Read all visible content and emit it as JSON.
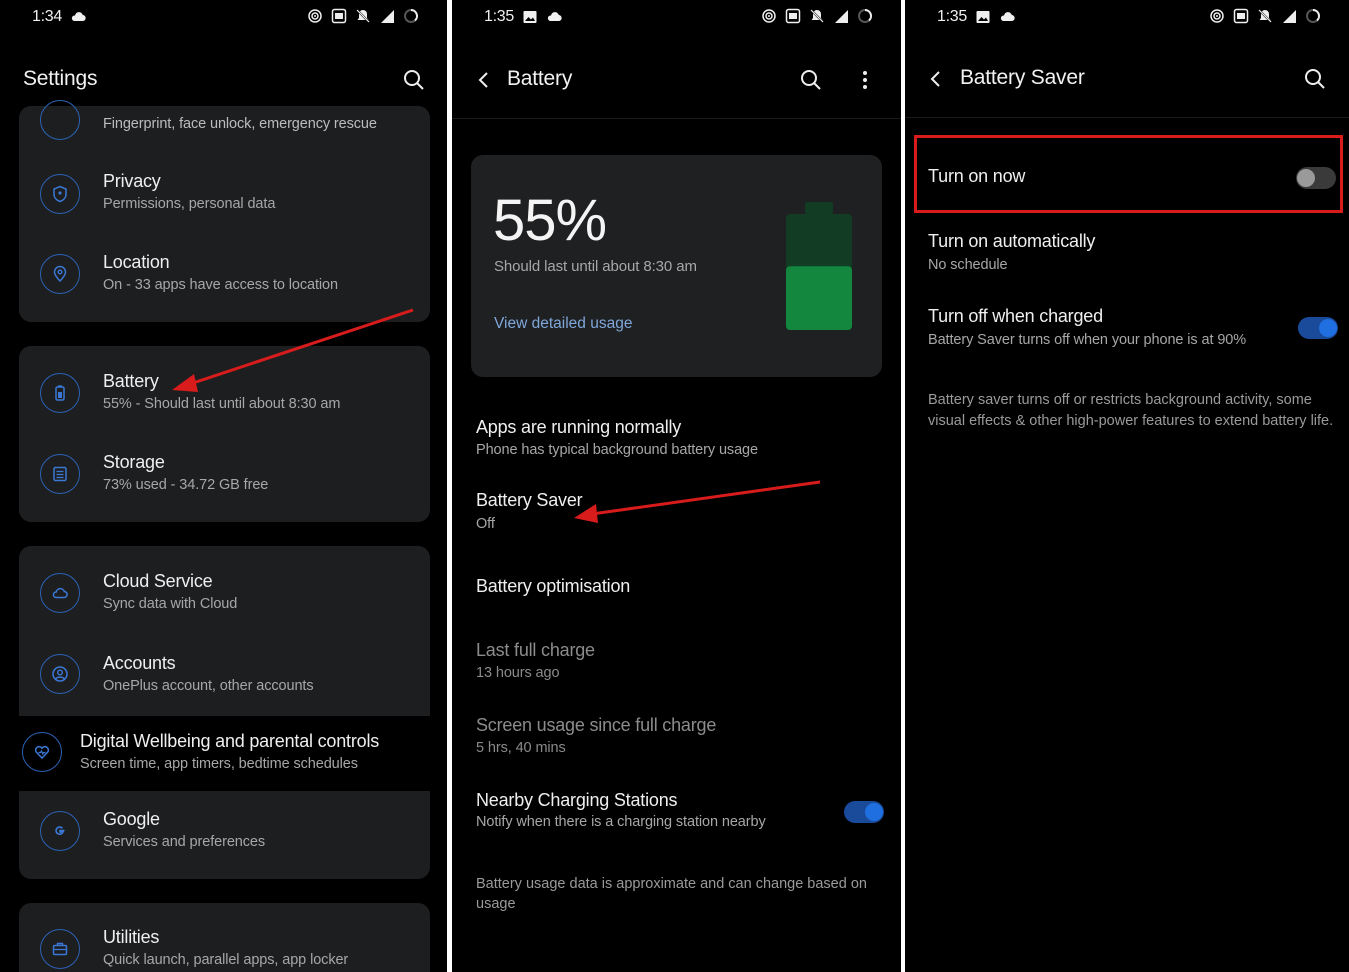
{
  "panel1": {
    "status": {
      "time": "1:34"
    },
    "title": "Settings",
    "partial_row_sub": "Fingerprint, face unlock, emergency rescue",
    "items": [
      {
        "title": "Privacy",
        "subtitle": "Permissions, personal data",
        "icon": "shield-icon"
      },
      {
        "title": "Location",
        "subtitle": "On - 33 apps have access to location",
        "icon": "location-pin-icon"
      },
      {
        "title": "Battery",
        "subtitle": "55% - Should last until about 8:30 am",
        "icon": "battery-icon"
      },
      {
        "title": "Storage",
        "subtitle": "73% used - 34.72 GB free",
        "icon": "storage-icon"
      },
      {
        "title": "Cloud Service",
        "subtitle": "Sync data with Cloud",
        "icon": "cloud-icon"
      },
      {
        "title": "Accounts",
        "subtitle": "OnePlus account, other accounts",
        "icon": "account-icon"
      },
      {
        "title": "Digital Wellbeing and parental controls",
        "subtitle": "Screen time, app timers, bedtime schedules",
        "icon": "heart-icon"
      },
      {
        "title": "Google",
        "subtitle": "Services and preferences",
        "icon": "google-icon"
      },
      {
        "title": "Utilities",
        "subtitle": "Quick launch, parallel apps, app locker",
        "icon": "toolbox-icon"
      }
    ]
  },
  "panel2": {
    "status": {
      "time": "1:35"
    },
    "title": "Battery",
    "level": "55%",
    "level_fraction": 0.55,
    "estimate": "Should last until about 8:30 am",
    "detail_link": "View detailed usage",
    "rows": [
      {
        "title": "Apps are running normally",
        "subtitle": "Phone has typical background battery usage"
      },
      {
        "title": "Battery Saver",
        "subtitle": "Off"
      },
      {
        "title": "Battery optimisation"
      },
      {
        "title": "Last full charge",
        "subtitle": "13 hours ago"
      },
      {
        "title": "Screen usage since full charge",
        "subtitle": "5 hrs, 40 mins"
      },
      {
        "title": "Nearby Charging Stations",
        "subtitle": "Notify when there is a charging station nearby",
        "toggle": true
      }
    ],
    "footer": "Battery usage data is approximate and can change based on usage"
  },
  "panel3": {
    "status": {
      "time": "1:35"
    },
    "title": "Battery Saver",
    "rows": [
      {
        "title": "Turn on now",
        "toggle": false
      },
      {
        "title": "Turn on automatically",
        "subtitle": "No schedule"
      },
      {
        "title": "Turn off when charged",
        "subtitle": "Battery Saver turns off when your phone is at 90%",
        "toggle": true
      }
    ],
    "description": "Battery saver turns off or restricts background activity, some visual effects & other high-power features to extend battery life."
  },
  "colors": {
    "background": "#000000",
    "card": "#1d1e20",
    "accent": "#1f6fe0",
    "battery_green": "#13873e",
    "link": "#7fa7d9",
    "annotation_red": "#d81b1b"
  }
}
